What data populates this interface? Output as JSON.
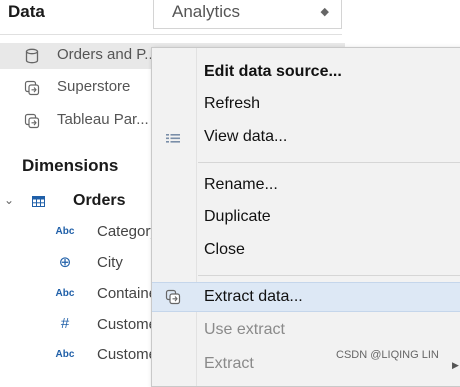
{
  "panel": {
    "title": "Data",
    "analytics_tab": "Analytics",
    "tab_arrows": "↕"
  },
  "data_sources": [
    {
      "label": "Orders and P...",
      "icon": "cylinder-icon",
      "selected": true
    },
    {
      "label": "Superstore",
      "icon": "linked-datasource-icon",
      "selected": false
    },
    {
      "label": "Tableau Par...",
      "icon": "linked-datasource-icon",
      "selected": false
    }
  ],
  "dimensions": {
    "title": "Dimensions",
    "table_name": "Orders",
    "fields": [
      {
        "type": "Abc",
        "label": "Category"
      },
      {
        "type": "⊕",
        "label": "City"
      },
      {
        "type": "Abc",
        "label": "Container"
      },
      {
        "type": "#",
        "label": "Customer ID"
      },
      {
        "type": "Abc",
        "label": "Customer Name"
      }
    ]
  },
  "context_menu": {
    "items": [
      {
        "label": "Edit data source...",
        "bold": true
      },
      {
        "label": "Refresh"
      },
      {
        "label": "View data...",
        "icon": "view-data-icon"
      },
      {
        "label": "Rename..."
      },
      {
        "label": "Duplicate"
      },
      {
        "label": "Close"
      },
      {
        "label": "Extract data...",
        "icon": "extract-icon",
        "highlighted": true
      },
      {
        "label": "Use extract",
        "disabled": true
      },
      {
        "label": "Extract",
        "disabled": true,
        "submenu": true
      }
    ]
  },
  "watermark": "CSDN @LIQING LIN"
}
